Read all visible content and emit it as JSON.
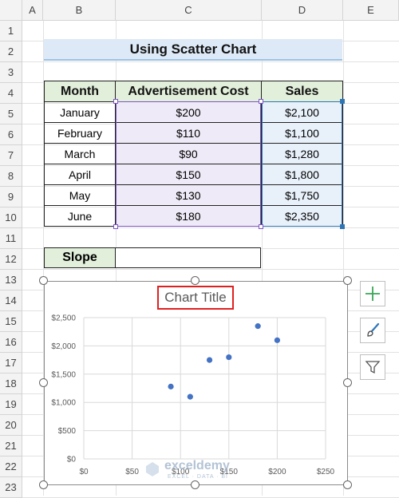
{
  "columns": [
    "A",
    "B",
    "C",
    "D",
    "E"
  ],
  "rows": [
    "1",
    "2",
    "3",
    "4",
    "5",
    "6",
    "7",
    "8",
    "9",
    "10",
    "11",
    "12",
    "13",
    "14",
    "15",
    "16",
    "17",
    "18",
    "19",
    "20",
    "21",
    "22",
    "23"
  ],
  "sheet": {
    "title": "Using Scatter Chart",
    "headers": [
      "Month",
      "Advertisement Cost",
      "Sales"
    ],
    "records": [
      {
        "month": "January",
        "adv": "$200",
        "sales": "$2,100"
      },
      {
        "month": "February",
        "adv": "$110",
        "sales": "$1,100"
      },
      {
        "month": "March",
        "adv": "$90",
        "sales": "$1,280"
      },
      {
        "month": "April",
        "adv": "$150",
        "sales": "$1,800"
      },
      {
        "month": "May",
        "adv": "$130",
        "sales": "$1,750"
      },
      {
        "month": "June",
        "adv": "$180",
        "sales": "$2,350"
      }
    ],
    "slope_label": "Slope",
    "slope_value": ""
  },
  "colors": {
    "header_fill": "#e2efda",
    "title_fill": "#dde9f6",
    "point": "#4472c4",
    "title_highlight": "#e02020",
    "adv_selection": "#7e57c2",
    "sales_selection": "#2e75b6"
  },
  "chart_buttons": [
    {
      "name": "chart-elements-button",
      "icon": "plus-icon"
    },
    {
      "name": "chart-styles-button",
      "icon": "paintbrush-icon"
    },
    {
      "name": "chart-filters-button",
      "icon": "funnel-icon"
    }
  ],
  "watermark": {
    "name": "exceldemy",
    "tagline": "EXCEL · DATA · BI"
  },
  "chart_data": {
    "type": "scatter",
    "title": "Chart Title",
    "x": [
      200,
      110,
      90,
      150,
      130,
      180
    ],
    "y": [
      2100,
      1100,
      1280,
      1800,
      1750,
      2350
    ],
    "xlim": [
      0,
      250
    ],
    "ylim": [
      0,
      2500
    ],
    "x_ticks": [
      "$0",
      "$50",
      "$100",
      "$150",
      "$200",
      "$250"
    ],
    "y_ticks": [
      "$0",
      "$500",
      "$1,000",
      "$1,500",
      "$2,000",
      "$2,500"
    ],
    "grid": true,
    "legend": "none"
  }
}
